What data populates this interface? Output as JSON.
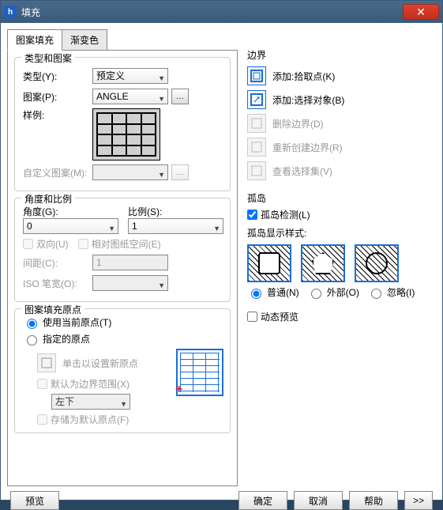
{
  "window": {
    "title": "填充"
  },
  "tabs": {
    "hatch": "图案填充",
    "gradient": "渐变色"
  },
  "type_group": {
    "title": "类型和图案",
    "type_label": "类型(Y):",
    "type_value": "预定义",
    "pattern_label": "图案(P):",
    "pattern_value": "ANGLE",
    "sample_label": "样例:",
    "custom_label": "自定义图案(M):"
  },
  "angle_group": {
    "title": "角度和比例",
    "angle_label": "角度(G):",
    "angle_value": "0",
    "scale_label": "比例(S):",
    "scale_value": "1",
    "bidir_label": "双向(U)",
    "paper_label": "相对图纸空间(E)",
    "spacing_label": "间距(C):",
    "spacing_value": "1",
    "iso_label": "ISO 笔宽(O):"
  },
  "origin_group": {
    "title": "图案填充原点",
    "use_current": "使用当前原点(T)",
    "specified": "指定的原点",
    "click_new": "单击以设置新原点",
    "default_extents": "默认为边界范围(X)",
    "extent_value": "左下",
    "store_default": "存储为默认原点(F)"
  },
  "boundary": {
    "title": "边界",
    "add_pick": "添加:拾取点(K)",
    "add_select": "添加:选择对象(B)",
    "delete": "删除边界(D)",
    "recreate": "重新创建边界(R)",
    "view_set": "查看选择集(V)"
  },
  "islands": {
    "title": "孤岛",
    "detect": "孤岛检测(L)",
    "style_label": "孤岛显示样式:",
    "normal": "普通(N)",
    "outer": "外部(O)",
    "ignore": "忽略(I)"
  },
  "dynamic_preview": "动态预览",
  "buttons": {
    "preview": "预览",
    "ok": "确定",
    "cancel": "取消",
    "help": "帮助",
    "expand": ">>"
  }
}
